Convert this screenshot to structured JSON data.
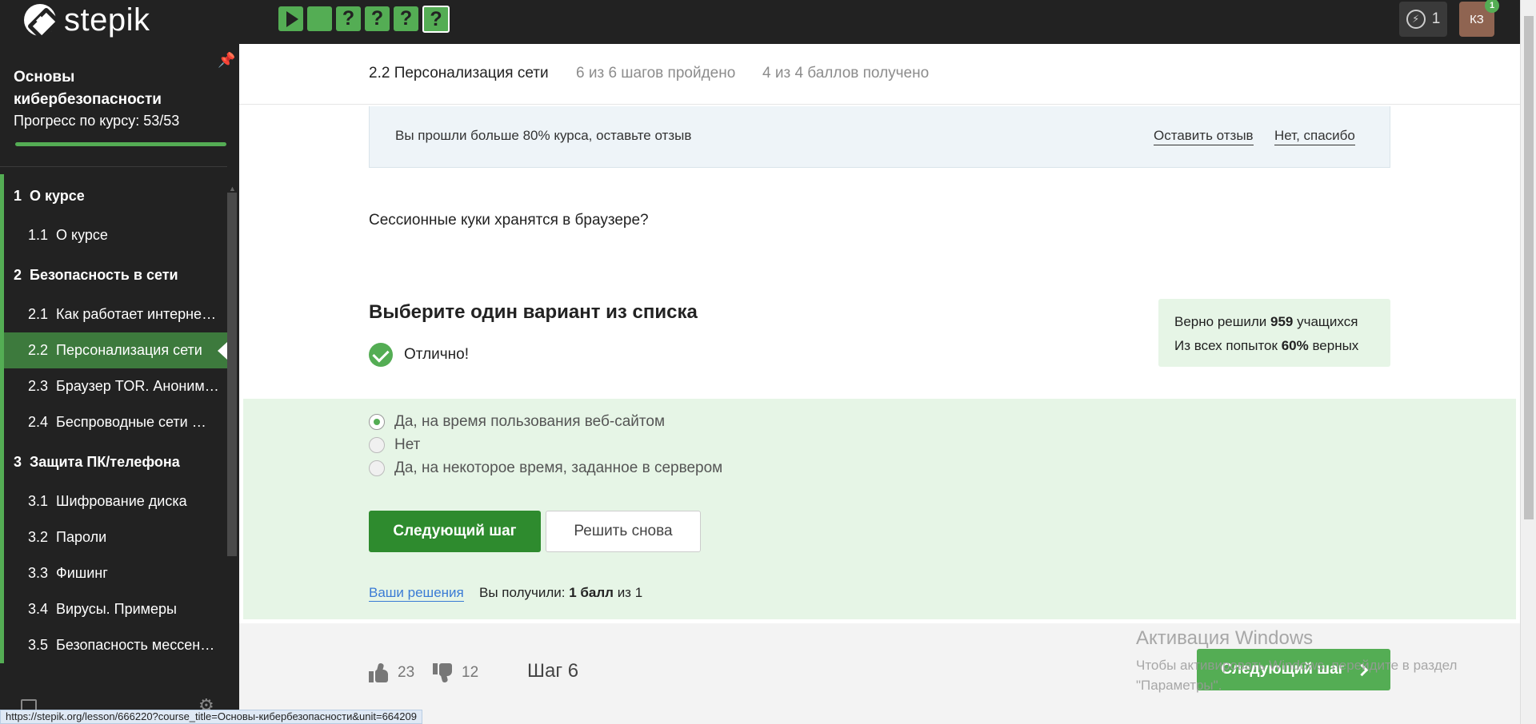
{
  "topbar": {
    "logo_text": "stepik",
    "steps": [
      {
        "kind": "play",
        "label": ""
      },
      {
        "kind": "done",
        "label": ""
      },
      {
        "kind": "quiz",
        "label": "?"
      },
      {
        "kind": "quiz",
        "label": "?"
      },
      {
        "kind": "quiz",
        "label": "?"
      },
      {
        "kind": "quiz-current",
        "label": "?"
      }
    ],
    "energy_count": "1",
    "avatar_initials": "КЗ",
    "avatar_badge": "1"
  },
  "sidebar": {
    "course_title": "Основы кибербезопасности",
    "progress_label": "Прогресс по курсу:",
    "progress_value": "53/53",
    "progress_fraction": 1.0,
    "items": [
      {
        "type": "section",
        "num": "1",
        "label": "О курсе"
      },
      {
        "type": "lesson",
        "num": "1.1",
        "label": "О курсе"
      },
      {
        "type": "section",
        "num": "2",
        "label": "Безопасность в сети"
      },
      {
        "type": "lesson",
        "num": "2.1",
        "label": "Как работает интерне…"
      },
      {
        "type": "lesson",
        "num": "2.2",
        "label": "Персонализация сети",
        "active": true
      },
      {
        "type": "lesson",
        "num": "2.3",
        "label": "Браузер TOR. Аноним…"
      },
      {
        "type": "lesson",
        "num": "2.4",
        "label": "Беспроводные сети …"
      },
      {
        "type": "section",
        "num": "3",
        "label": "Защита ПК/телефона"
      },
      {
        "type": "lesson",
        "num": "3.1",
        "label": "Шифрование диска"
      },
      {
        "type": "lesson",
        "num": "3.2",
        "label": "Пароли"
      },
      {
        "type": "lesson",
        "num": "3.3",
        "label": "Фишинг"
      },
      {
        "type": "lesson",
        "num": "3.4",
        "label": "Вирусы. Примеры"
      },
      {
        "type": "lesson",
        "num": "3.5",
        "label": "Безопасность мессен…"
      }
    ]
  },
  "lesson_header": {
    "title": "2.2 Персонализация сети",
    "steps_done": "6 из 6 шагов пройдено",
    "score": "4 из 4 баллов  получено"
  },
  "review_banner": {
    "text": "Вы прошли больше 80% курса, оставьте отзыв",
    "leave_review": "Оставить отзыв",
    "no_thanks": "Нет, спасибо"
  },
  "question": "Сессионные куки хранятся в браузере?",
  "task": {
    "title": "Выберите один вариант из списка",
    "status_text": "Отлично!",
    "stats_line1_prefix": "Верно решили",
    "stats_solved": "959",
    "stats_line1_suffix": "учащихся",
    "stats_line2_prefix": "Из всех попыток",
    "stats_percent": "60%",
    "stats_line2_suffix": "верных",
    "options": [
      {
        "label": "Да, на время пользования веб-сайтом",
        "checked": true
      },
      {
        "label": "Нет",
        "checked": false
      },
      {
        "label": "Да, на некоторое время, заданное в сервером",
        "checked": false
      }
    ],
    "next_button": "Следующий шаг",
    "retry_button": "Решить снова",
    "solutions_link": "Ваши решения",
    "result_prefix": "Вы получили:",
    "result_points": "1 балл",
    "result_suffix": "из 1"
  },
  "footer": {
    "likes": "23",
    "dislikes": "12",
    "step_label": "Шаг 6",
    "next_button": "Следующий шаг"
  },
  "watermark": {
    "title": "Активация Windows",
    "subtitle": "Чтобы активировать Windows, перейдите в раздел \"Параметры\"."
  },
  "status_url": "https://stepik.org/lesson/666220?course_title=Основы-кибербезопасности&unit=664209",
  "colors": {
    "accent_green": "#54ad54",
    "dark_bg": "#222222",
    "link_blue": "#3a7bd5"
  }
}
